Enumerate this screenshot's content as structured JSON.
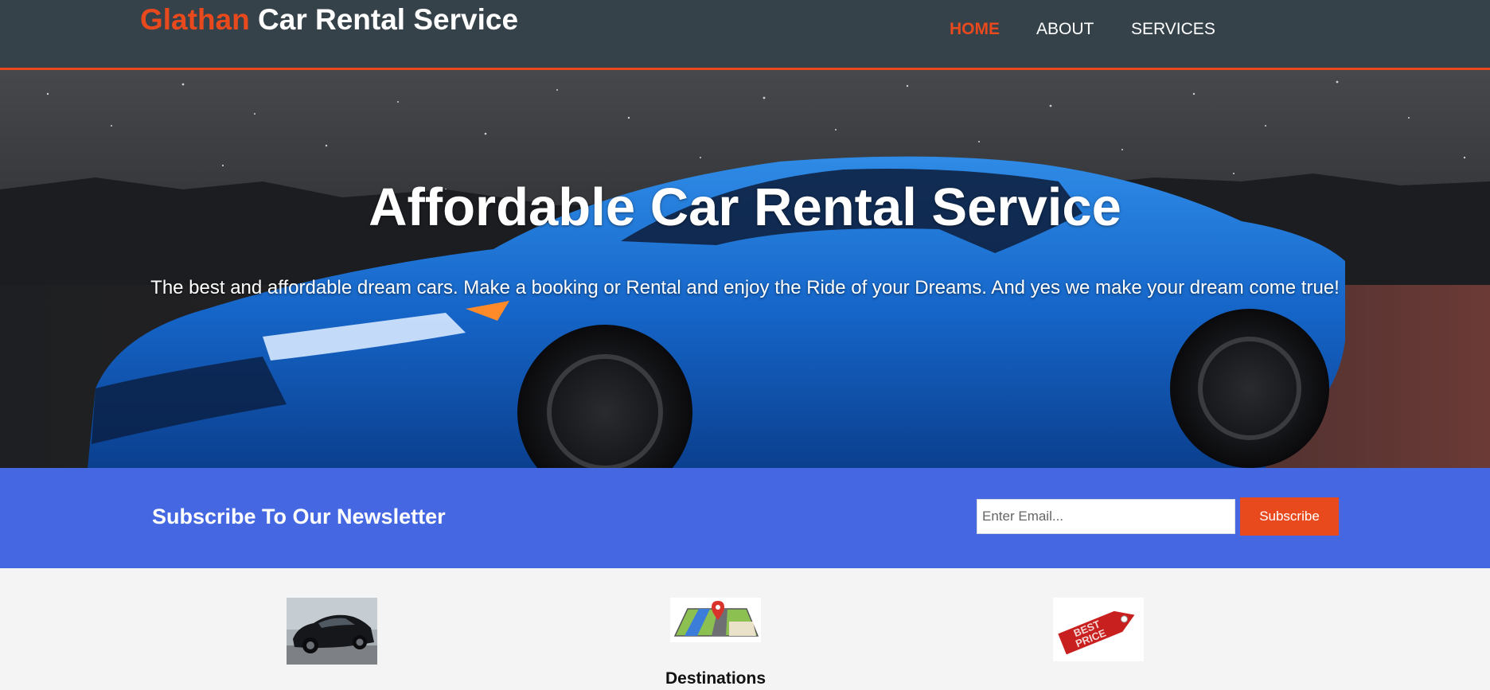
{
  "header": {
    "brand_highlight": "Glathan",
    "brand_rest": " Car Rental Service",
    "nav": [
      {
        "label": "HOME",
        "current": true
      },
      {
        "label": "ABOUT",
        "current": false
      },
      {
        "label": "SERVICES",
        "current": false
      }
    ]
  },
  "hero": {
    "title": "Affordable Car Rental Service",
    "text": "The best and affordable dream cars. Make a booking or Rental and enjoy the Ride of your Dreams. And yes we make your dream come true!"
  },
  "newsletter": {
    "title": "Subscribe To Our Newsletter",
    "email_placeholder": "Enter Email...",
    "button_label": "Subscribe"
  },
  "boxes": [
    {
      "title": "",
      "image": "black-sedan-car-photo"
    },
    {
      "title": "Destinations",
      "image": "map-pin-icon"
    },
    {
      "title": "",
      "image": "best-price-tag-icon",
      "image_text": "BEST PRICE"
    }
  ],
  "colors": {
    "header_bg": "#35424a",
    "accent": "#e8491d",
    "newsletter_bg": "#4568e2",
    "page_bg": "#f4f4f4"
  }
}
